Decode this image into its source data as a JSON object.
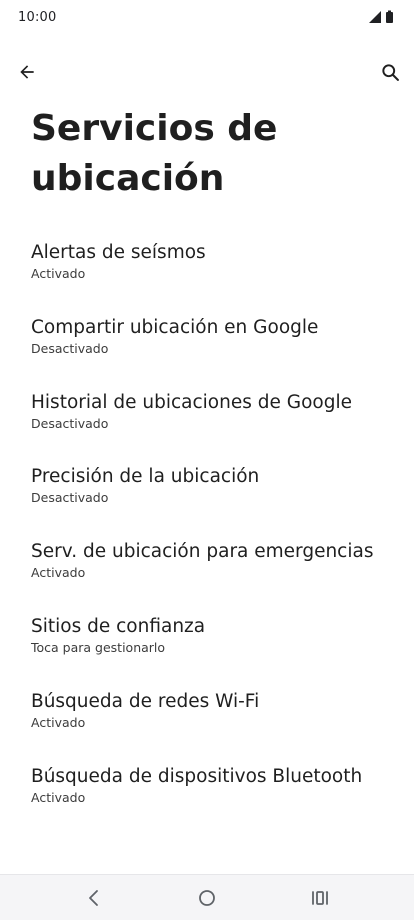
{
  "status_bar": {
    "time": "10:00",
    "icons": [
      "signal-icon",
      "battery-icon"
    ]
  },
  "app_bar": {
    "back_icon": "arrow-back-icon",
    "search_icon": "search-icon"
  },
  "page": {
    "title": "Servicios de ubicación"
  },
  "settings": [
    {
      "title": "Alertas de seísmos",
      "summary": "Activado"
    },
    {
      "title": "Compartir ubicación en Google",
      "summary": "Desactivado"
    },
    {
      "title": "Historial de ubicaciones de Google",
      "summary": "Desactivado"
    },
    {
      "title": "Precisión de la ubicación",
      "summary": "Desactivado"
    },
    {
      "title": "Serv. de ubicación para emergencias",
      "summary": "Activado"
    },
    {
      "title": "Sitios de confianza",
      "summary": "Toca para gestionarlo"
    },
    {
      "title": "Búsqueda de redes Wi-Fi",
      "summary": "Activado"
    },
    {
      "title": "Búsqueda de dispositivos Bluetooth",
      "summary": "Activado"
    }
  ],
  "nav_bar": {
    "icons": [
      "nav-back-icon",
      "nav-home-icon",
      "nav-recents-icon"
    ]
  },
  "colors": {
    "text_primary": "#1f1f1f",
    "text_secondary": "#3c3c3c",
    "nav_background": "#f5f5f7",
    "background": "#ffffff"
  }
}
